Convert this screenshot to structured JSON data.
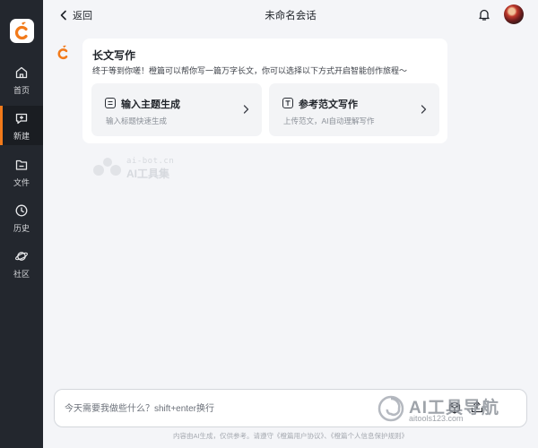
{
  "header": {
    "back_label": "返回",
    "title": "未命名会话"
  },
  "sidebar": {
    "items": [
      {
        "label": "首页",
        "icon": "home-icon"
      },
      {
        "label": "新建",
        "icon": "new-chat-icon",
        "active": true
      },
      {
        "label": "文件",
        "icon": "folder-icon"
      },
      {
        "label": "历史",
        "icon": "clock-icon"
      },
      {
        "label": "社区",
        "icon": "planet-icon"
      }
    ]
  },
  "card": {
    "title": "长文写作",
    "description": "终于等到你嗟！橙篇可以帮你写一篇万字长文，你可以选择以下方式开启智能创作旅程～",
    "options": [
      {
        "title": "输入主题生成",
        "subtitle": "输入标题快速生成",
        "icon": "document-icon"
      },
      {
        "title": "参考范文写作",
        "subtitle": "上传范文，AI自动理解写作",
        "icon": "text-t-icon"
      }
    ]
  },
  "watermark": {
    "line1": "ai-bot.cn",
    "line2": "AI工具集"
  },
  "input": {
    "placeholder": "今天需要我做些什么？shift+enter换行"
  },
  "footer": {
    "note": "内容由AI生成，仅供参考。请遵守《橙篇用户协议》、《橙篇个人信息保护规则》"
  },
  "watermark2": {
    "text": "AI工具导航",
    "sub": "aitools123.com"
  },
  "colors": {
    "sidebar_bg": "#23272e",
    "accent": "#f27a1a",
    "page_bg": "#f4f5f8"
  }
}
